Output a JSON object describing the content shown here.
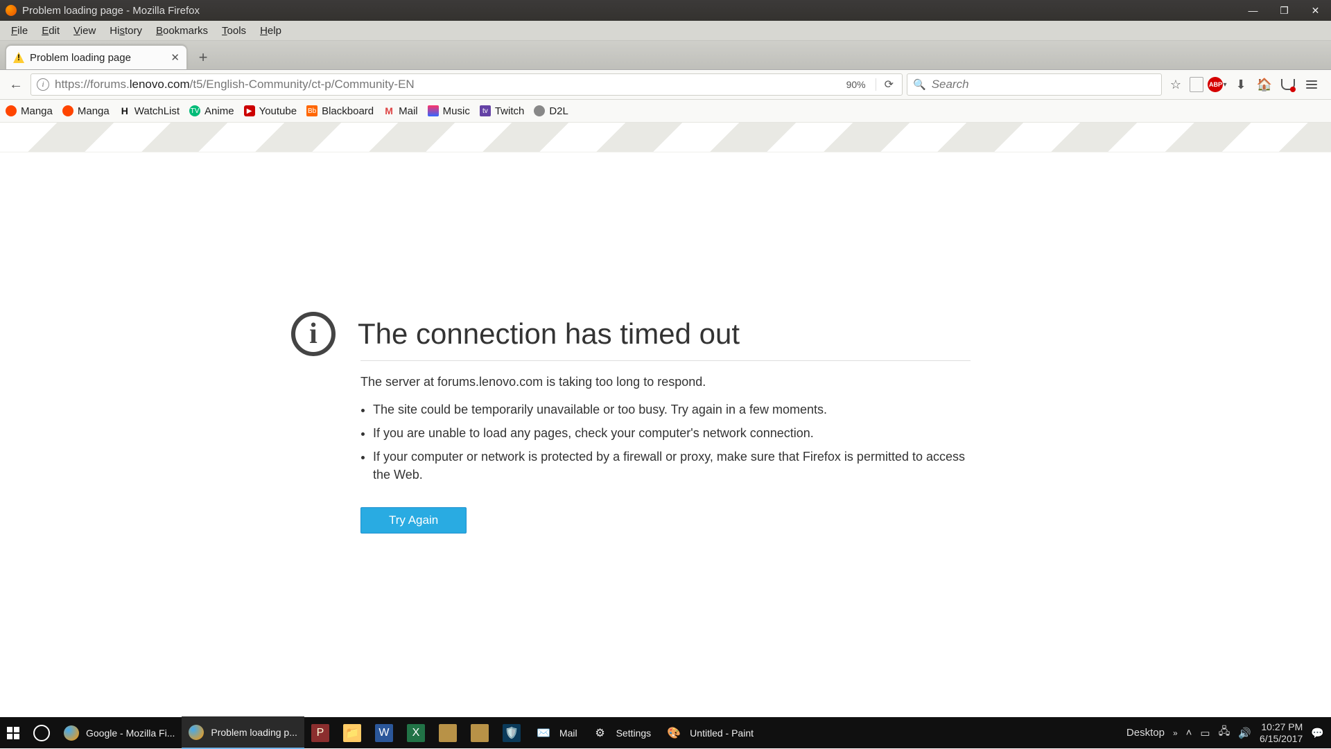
{
  "window": {
    "title": "Problem loading page - Mozilla Firefox"
  },
  "menubar": {
    "items": [
      "File",
      "Edit",
      "View",
      "History",
      "Bookmarks",
      "Tools",
      "Help"
    ]
  },
  "tab": {
    "title": "Problem loading page"
  },
  "urlbar": {
    "scheme": "https://",
    "host_pre": "forums.",
    "host_bold": "lenovo.com",
    "path": "/t5/English-Community/ct-p/Community-EN",
    "zoom": "90%"
  },
  "search": {
    "placeholder": "Search"
  },
  "bookmarks": [
    "Manga",
    "Manga",
    "WatchList",
    "Anime",
    "Youtube",
    "Blackboard",
    "Mail",
    "Music",
    "Twitch",
    "D2L"
  ],
  "error": {
    "title": "The connection has timed out",
    "subtitle": "The server at forums.lenovo.com is taking too long to respond.",
    "points": [
      "The site could be temporarily unavailable or too busy. Try again in a few moments.",
      "If you are unable to load any pages, check your computer's network connection.",
      "If your computer or network is protected by a firewall or proxy, make sure that Firefox is permitted to access the Web."
    ],
    "button": "Try Again"
  },
  "taskbar": {
    "items": [
      {
        "label": "Google - Mozilla Fi..."
      },
      {
        "label": "Problem loading p..."
      },
      {
        "label": "Mail"
      },
      {
        "label": "Settings"
      },
      {
        "label": "Untitled - Paint"
      }
    ],
    "desktop_label": "Desktop",
    "clock": {
      "time": "10:27 PM",
      "date": "6/15/2017"
    }
  }
}
